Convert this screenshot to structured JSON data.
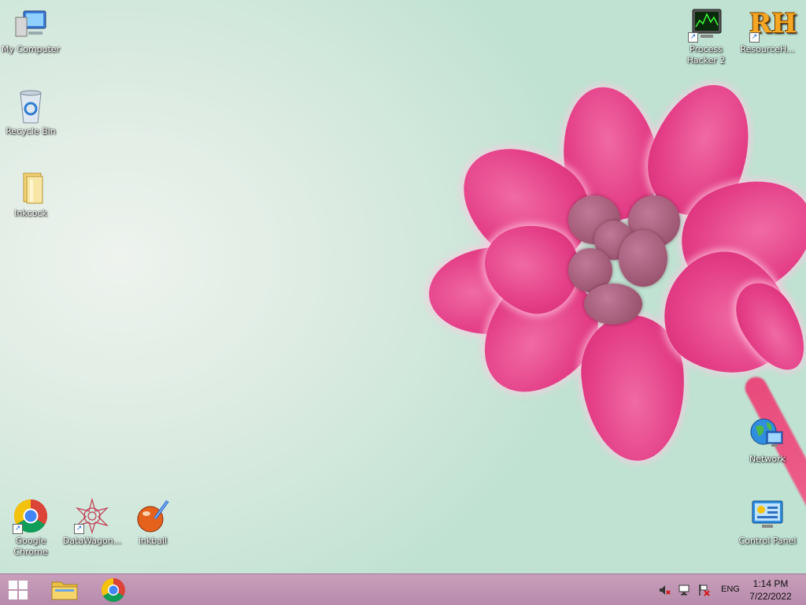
{
  "desktop": {
    "icons_left": [
      {
        "label": "My Computer",
        "icon": "computer-icon"
      },
      {
        "label": "Recycle Bin",
        "icon": "recycle-bin-icon"
      },
      {
        "label": "Inkcock",
        "icon": "folder-icon"
      }
    ],
    "icons_bottom": [
      {
        "label": "Google Chrome",
        "icon": "chrome-icon"
      },
      {
        "label": "DataWagon...",
        "icon": "datawagon-icon"
      },
      {
        "label": "inkball",
        "icon": "inkball-icon"
      }
    ],
    "icons_right": [
      {
        "label": "Process Hacker 2",
        "icon": "process-hacker-icon"
      },
      {
        "label": "ResourceH...",
        "icon": "resource-hacker-icon",
        "glyph": "RH"
      },
      {
        "label": "Network",
        "icon": "network-icon"
      },
      {
        "label": "Control Panel",
        "icon": "control-panel-icon"
      }
    ]
  },
  "taskbar": {
    "pinned": [
      "file-explorer-icon",
      "chrome-icon"
    ],
    "language": "ENG",
    "time": "1:14 PM",
    "date": "7/22/2022"
  },
  "colors": {
    "taskbar": "#b78aab",
    "petal": "#e43f87"
  }
}
